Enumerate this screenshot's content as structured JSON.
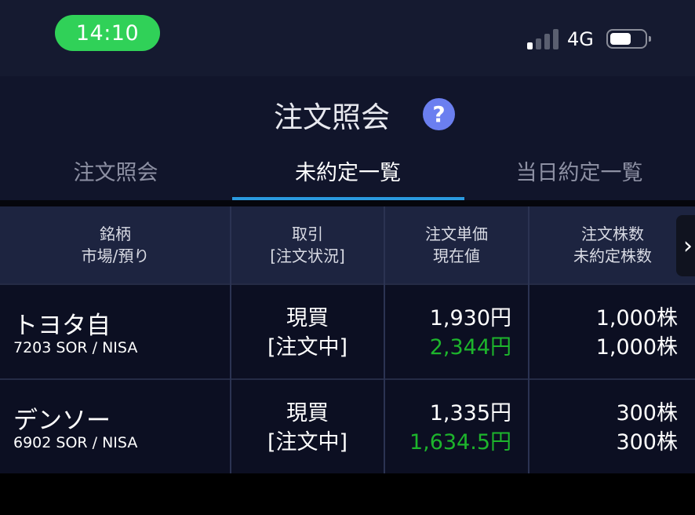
{
  "status_bar": {
    "time": "14:10",
    "network": "4G",
    "signal_bars_filled": 1,
    "signal_bars_total": 4,
    "battery_level": 0.6,
    "time_pill_color": "#30d158"
  },
  "header": {
    "title": "注文照会",
    "help_icon": "question-circle-icon",
    "tabs": [
      {
        "label": "注文照会",
        "active": false
      },
      {
        "label": "未約定一覧",
        "active": true
      },
      {
        "label": "当日約定一覧",
        "active": false
      }
    ],
    "accent_color": "#2b9ae0"
  },
  "table": {
    "columns": [
      {
        "line1": "銘柄",
        "line2": "市場/預り"
      },
      {
        "line1": "取引",
        "line2": "[注文状況]"
      },
      {
        "line1": "注文単価",
        "line2": "現在値"
      },
      {
        "line1": "注文株数",
        "line2": "未約定株数"
      }
    ],
    "scroll_icon": "chevron-right-icon",
    "rows": [
      {
        "name": "トヨタ自",
        "market": "7203 SOR / NISA",
        "trade": "現買",
        "status": "[注文中]",
        "order_price": "1,930円",
        "current_price": "2,344円",
        "order_qty": "1,000株",
        "unfilled_qty": "1,000株"
      },
      {
        "name": "デンソー",
        "market": "6902 SOR / NISA",
        "trade": "現買",
        "status": "[注文中]",
        "order_price": "1,335円",
        "current_price": "1,634.5円",
        "order_qty": "300株",
        "unfilled_qty": "300株"
      }
    ],
    "price_up_color": "#1db52c"
  }
}
